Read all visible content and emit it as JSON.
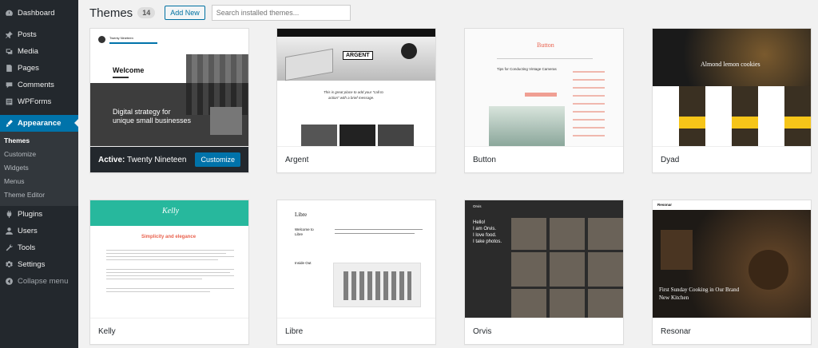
{
  "sidebar": {
    "items": [
      {
        "label": "Dashboard",
        "icon": "dashboard-icon"
      },
      {
        "label": "Posts",
        "icon": "pin-icon"
      },
      {
        "label": "Media",
        "icon": "media-icon"
      },
      {
        "label": "Pages",
        "icon": "pages-icon"
      },
      {
        "label": "Comments",
        "icon": "comment-icon"
      },
      {
        "label": "WPForms",
        "icon": "form-icon"
      },
      {
        "label": "Appearance",
        "icon": "brush-icon"
      },
      {
        "label": "Plugins",
        "icon": "plugin-icon"
      },
      {
        "label": "Users",
        "icon": "user-icon"
      },
      {
        "label": "Tools",
        "icon": "wrench-icon"
      },
      {
        "label": "Settings",
        "icon": "settings-icon"
      },
      {
        "label": "Collapse menu",
        "icon": "collapse-icon"
      }
    ],
    "submenu": [
      "Themes",
      "Customize",
      "Widgets",
      "Menus",
      "Theme Editor"
    ]
  },
  "header": {
    "title": "Themes",
    "count": "14",
    "add_new": "Add New",
    "search_placeholder": "Search installed themes..."
  },
  "themes": [
    {
      "name": "Twenty Nineteen",
      "active_prefix": "Active:",
      "customize": "Customize"
    },
    {
      "name": "Argent"
    },
    {
      "name": "Button"
    },
    {
      "name": "Dyad"
    },
    {
      "name": "Kelly"
    },
    {
      "name": "Libre"
    },
    {
      "name": "Orvis"
    },
    {
      "name": "Resonar"
    }
  ],
  "previews": {
    "twenty": {
      "site": "Twenty Nineteen",
      "welcome": "Welcome",
      "headline1": "Digital strategy for",
      "headline2": "unique small businesses"
    },
    "argent": {
      "logo": "ARGENT",
      "quote1": "This is great place to add your \"call to",
      "quote2": "action\" with a brief message."
    },
    "button": {
      "logo": "Button",
      "post_title": "Tips for Conducting Vintage Cameras"
    },
    "dyad": {
      "hero": "Almond lemon cookies"
    },
    "kelly": {
      "logo": "Kelly",
      "heading": "Simplicity and elegance"
    },
    "libre": {
      "logo": "Libre",
      "welcome1": "Welcome to",
      "welcome2": "Libre",
      "inside": "Inside Out"
    },
    "orvis": {
      "logo": "Orvis",
      "intro": [
        "Hello!",
        "I am Orvis.",
        "I love food.",
        "I take photos."
      ]
    },
    "resonar": {
      "logo": "Resonar",
      "headline1": "First Sunday Cooking in Our Brand",
      "headline2": "New Kitchen"
    }
  },
  "colors": {
    "sidebar_bg": "#23282d",
    "accent": "#0073aa",
    "page_bg": "#f1f1f1",
    "kelly_teal": "#27b89d",
    "button_orange": "#e9624e",
    "dyad_yellow": "#f6c519"
  }
}
